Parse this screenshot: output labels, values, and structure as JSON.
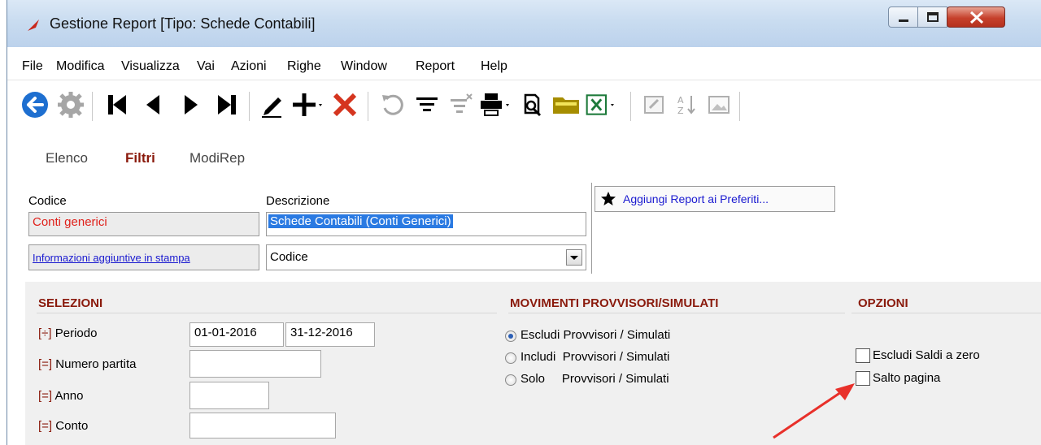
{
  "window": {
    "title": "Gestione Report [Tipo: Schede Contabili]"
  },
  "menu": [
    "File",
    "Modifica",
    "Visualizza",
    "Vai",
    "Azioni",
    "Righe",
    "Window",
    "Report",
    "Help"
  ],
  "toolbar": {
    "icons": [
      "back-icon",
      "settings-icon",
      "first-record-icon",
      "previous-record-icon",
      "next-record-icon",
      "last-record-icon",
      "edit-icon",
      "add-icon",
      "delete-icon",
      "undo-icon",
      "filter-icon",
      "clear-filter-icon",
      "print-icon",
      "preview-icon",
      "folder-icon",
      "excel-icon",
      "edit-doc-icon",
      "sort-icon",
      "image-icon"
    ]
  },
  "tabs": [
    "Elenco",
    "Filtri",
    "ModiRep"
  ],
  "form": {
    "codice_label": "Codice",
    "codice_value": "Conti generici",
    "descrizione_label": "Descrizione",
    "descrizione_value": "Schede Contabili (Conti Generici)",
    "info_link": "Informazioni aggiuntive in stampa",
    "info_select": "Codice",
    "favorites_button": "Aggiungi Report ai Preferiti..."
  },
  "selezioni": {
    "title": "SELEZIONI",
    "rows": [
      {
        "prefix": "[÷]",
        "label": "Periodo",
        "value_from": "01-01-2016",
        "value_to": "31-12-2016"
      },
      {
        "prefix": "[=]",
        "label": "Numero partita",
        "value": ""
      },
      {
        "prefix": "[=]",
        "label": "Anno",
        "value": ""
      },
      {
        "prefix": "[=]",
        "label": "Conto",
        "value": ""
      }
    ]
  },
  "movimenti": {
    "title": "MOVIMENTI PROVVISORI/SIMULATI",
    "options": [
      {
        "label": "Escludi Provvisori / Simulati",
        "selected": true
      },
      {
        "label": "Includi  Provvisori / Simulati",
        "selected": false
      },
      {
        "label": "Solo     Provvisori / Simulati",
        "selected": false
      }
    ]
  },
  "opzioni": {
    "title": "OPZIONI",
    "checkboxes": [
      {
        "label": "Escludi Saldi a zero",
        "checked": false
      },
      {
        "label": "Salto pagina",
        "checked": false
      }
    ]
  },
  "colors": {
    "accent": "#8a1a0c",
    "link": "#1a1ad0",
    "annotation_arrow": "#e8302a"
  }
}
